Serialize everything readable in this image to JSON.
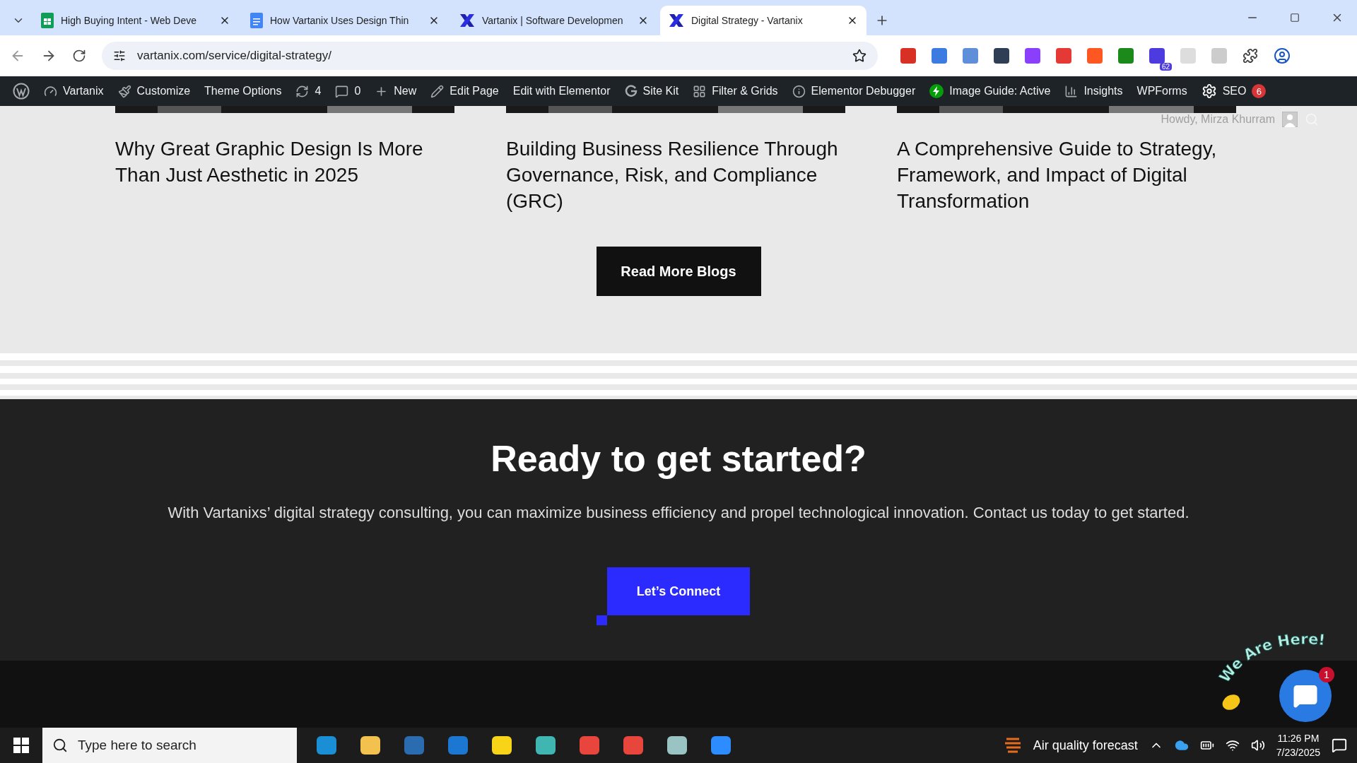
{
  "browser": {
    "tabs": [
      {
        "title": "High Buying Intent - Web Deve",
        "kind": "sheets",
        "selected": false
      },
      {
        "title": "How Vartanix Uses Design Thin",
        "kind": "docs",
        "selected": false
      },
      {
        "title": "Vartanix | Software Developmen",
        "kind": "brand",
        "selected": false
      },
      {
        "title": "Digital Strategy - Vartanix",
        "kind": "brand",
        "selected": true
      }
    ],
    "url": "vartanix.com/service/digital-strategy/",
    "extension_badge": "62"
  },
  "admin_bar": {
    "items": [
      {
        "kind": "wp"
      },
      {
        "kind": "gauge",
        "label": "Vartanix"
      },
      {
        "kind": "brush",
        "label": "Customize"
      },
      {
        "kind": "text",
        "label": "Theme Options"
      },
      {
        "kind": "refresh",
        "label": "4"
      },
      {
        "kind": "comment",
        "label": "0"
      },
      {
        "kind": "plus",
        "label": "New"
      },
      {
        "kind": "pencil",
        "label": "Edit Page"
      },
      {
        "kind": "text",
        "label": "Edit with Elementor"
      },
      {
        "kind": "g",
        "label": "Site Kit"
      },
      {
        "kind": "grid",
        "label": "Filter & Grids"
      },
      {
        "kind": "info",
        "label": "Elementor Debugger"
      },
      {
        "kind": "bolt",
        "label": "Image Guide: Active"
      },
      {
        "kind": "bars",
        "label": "Insights"
      },
      {
        "kind": "text",
        "label": "WPForms"
      },
      {
        "kind": "gear",
        "label": "SEO",
        "badge": "6"
      }
    ],
    "howdy": "Howdy, Mirza Khurram"
  },
  "posts": [
    {
      "title": "Why Great Graphic Design Is More Than Just Aesthetic in 2025"
    },
    {
      "title": "Building Business Resilience Through Governance, Risk, and Compliance (GRC)"
    },
    {
      "title": "A Comprehensive Guide to Strategy, Framework, and Impact of Digital Transformation"
    }
  ],
  "read_more": "Read More Blogs",
  "cta": {
    "heading": "Ready to get started?",
    "text": "With Vartanixs’ digital strategy consulting, you can maximize business efficiency and propel technological innovation. Contact us today to get started.",
    "button": "Let’s Connect"
  },
  "chat": {
    "caption": "We Are Here!",
    "badge": "1"
  },
  "taskbar": {
    "search_placeholder": "Type here to search",
    "weather": "Air quality forecast",
    "time": "11:26 PM",
    "date": "7/23/2025"
  }
}
